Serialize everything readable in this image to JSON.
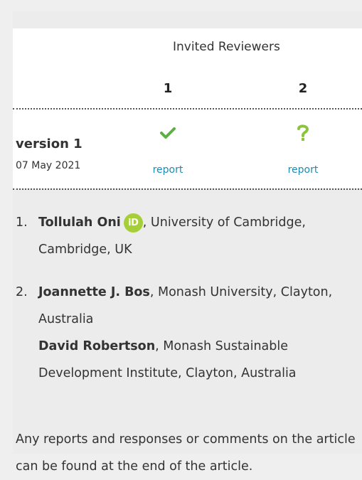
{
  "reviewers": {
    "heading": "Invited Reviewers",
    "columns": [
      "1",
      "2"
    ]
  },
  "versions": [
    {
      "label": "version 1",
      "date": "07 May 2021",
      "statuses": [
        {
          "icon": "checkmark-icon",
          "color": "#5bb042",
          "report_label": "report"
        },
        {
          "icon": "question-mark-icon",
          "color": "#8cc43f",
          "report_label": "report"
        }
      ]
    }
  ],
  "references": [
    {
      "number": "1.",
      "people": [
        {
          "name": "Tollulah Oni",
          "orcid_label": "iD",
          "affiliation": ", University of Cambridge, Cambridge, UK"
        }
      ]
    },
    {
      "number": "2.",
      "people": [
        {
          "name": "Joannette J. Bos",
          "affiliation": ", Monash University, Clayton, Australia"
        },
        {
          "name": "David Robertson",
          "affiliation": ", Monash Sustainable Development Institute, Clayton, Australia"
        }
      ]
    }
  ],
  "note": "Any reports and responses or comments on the article can be found at the end of the article.",
  "colors": {
    "link": "#1f8bb1",
    "orcid": "#a6ce39",
    "approved": "#5bb042",
    "reservations": "#8cc43f"
  }
}
